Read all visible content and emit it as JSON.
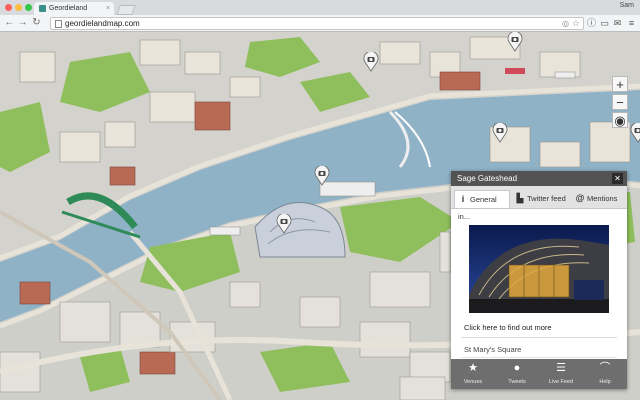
{
  "browser": {
    "tab_title": "Geordieland",
    "tab_close": "×",
    "user_name": "Sam",
    "back": "←",
    "forward": "→",
    "reload": "↻",
    "url": "geordielandmap.com",
    "bookmark": "☆",
    "ext_icons": [
      "◎",
      "ⓘ",
      "▭",
      "✉",
      "≡"
    ]
  },
  "map": {
    "zoom_in": "+",
    "zoom_out": "−",
    "locate": "◉",
    "photo_markers": 5
  },
  "panel": {
    "title": "Sage Gateshead",
    "close": "✕",
    "tabs": [
      {
        "icon": "i",
        "label": "General in..."
      },
      {
        "icon": "▙",
        "label": "Twitter feed"
      },
      {
        "icon": "@",
        "label": "Mentions"
      }
    ],
    "link_text": "Click here to find out more",
    "address": "St Mary's Square"
  },
  "bottom_nav": [
    {
      "icon": "★",
      "label": "Venues"
    },
    {
      "icon": "●",
      "label": "Tweets"
    },
    {
      "icon": "☰",
      "label": "Live Feed"
    },
    {
      "icon": "⌒",
      "label": "Help"
    }
  ],
  "colors": {
    "river": "#8fb2c7",
    "grass": "#8fbf5d",
    "road": "#e6e2d7",
    "panel_header": "#535353",
    "bottom_nav": "#6e6e6e",
    "bridge_green": "#2e8a57"
  }
}
